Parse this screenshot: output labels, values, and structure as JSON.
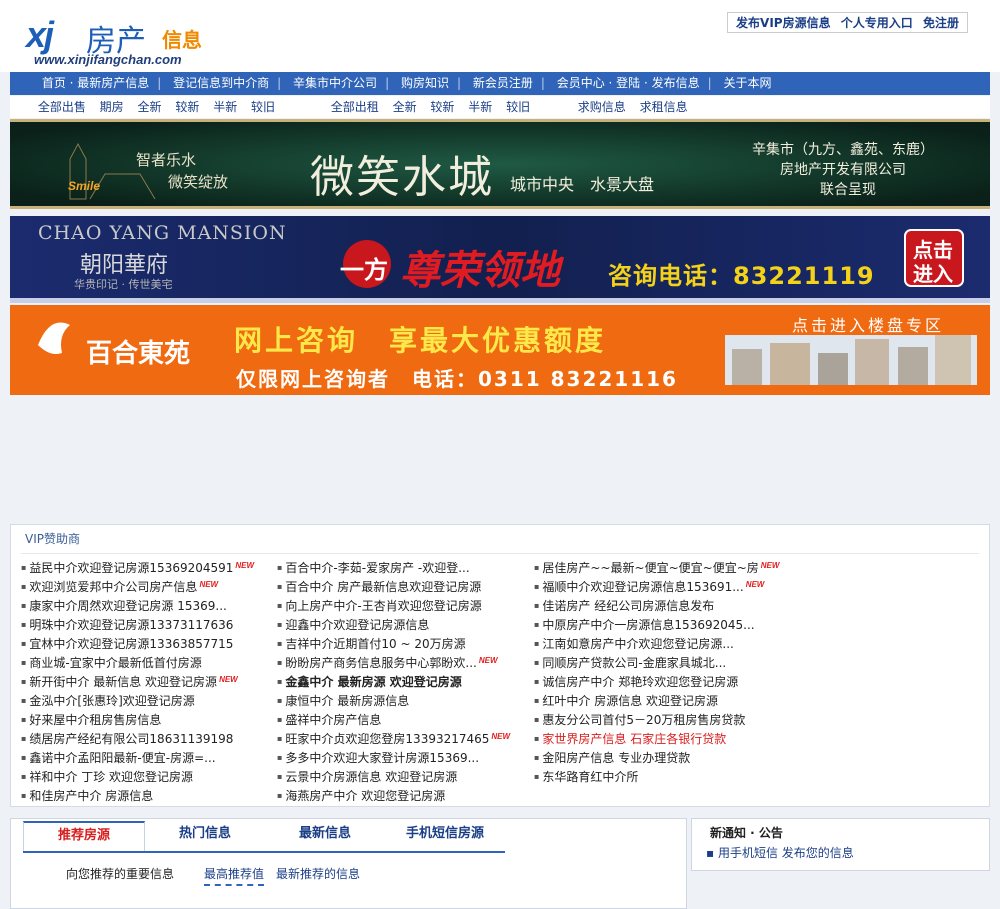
{
  "header": {
    "logo_xj": "xj",
    "logo_fc": "房产",
    "logo_xx": "信息",
    "logo_url": "www.xinjifangchan.com",
    "top_links": [
      "发布VIP房源信息",
      "个人专用入口",
      "免注册"
    ]
  },
  "nav": [
    "首页 · 最新房产信息",
    "登记信息到中介商",
    "辛集市中介公司",
    "购房知识",
    "新会员注册",
    "会员中心 · 登陆 · 发布信息",
    "关于本网"
  ],
  "subnav": {
    "sale": [
      "全部出售",
      "期房",
      "全新",
      "较新",
      "半新",
      "较旧"
    ],
    "rent": [
      "全部出租",
      "全新",
      "较新",
      "半新",
      "较旧"
    ],
    "other": [
      "求购信息",
      "求租信息"
    ]
  },
  "banners": {
    "b1": {
      "slogan1": "智者乐水",
      "slogan2": "微笑绽放",
      "brand": "Smile",
      "title": "微笑水城",
      "sub": "城市中央　水景大盘",
      "company1": "辛集市（九方、鑫苑、东鹿）",
      "company2": "房地产开发有限公司",
      "company3": "联合呈现"
    },
    "b2": {
      "en": "CHAO YANG MANSION",
      "cn": "朝阳華府",
      "slogan": "华贵印记 · 传世美宅",
      "one": "一方",
      "lead": "尊荣领地",
      "phone": "咨询电话：83221119",
      "btn1": "点击",
      "btn2": "进入"
    },
    "b3": {
      "name": "百合東苑",
      "line1": "网上咨询　享最大优惠额度",
      "line2": "仅限网上咨询者　电话：0311 83221116",
      "enter": "点击进入楼盘专区"
    }
  },
  "vip": {
    "title": "VIP赞助商",
    "col1": [
      {
        "t": "益民中介欢迎登记房源15369204591",
        "new": true
      },
      {
        "t": "欢迎浏览爱邦中介公司房产信息",
        "new": true
      },
      {
        "t": "康家中介周然欢迎登记房源 15369..."
      },
      {
        "t": "明珠中介欢迎登记房源13373117636"
      },
      {
        "t": "宜林中介欢迎登记房源13363857715"
      },
      {
        "t": "商业城-宜家中介最新低首付房源"
      },
      {
        "t": "新开街中介 最新信息 欢迎登记房源",
        "new": true
      },
      {
        "t": "金泓中介[张惠玲]欢迎登记房源"
      },
      {
        "t": "好来屋中介租房售房信息"
      },
      {
        "t": "绩居房产经纪有限公司18631139198"
      },
      {
        "t": "鑫诺中介孟阳阳最新-便宜-房源=..."
      },
      {
        "t": "祥和中介 丁珍 欢迎您登记房源"
      },
      {
        "t": "和佳房产中介 房源信息"
      }
    ],
    "col2": [
      {
        "t": "百合中介-李茹-爱家房产 -欢迎登..."
      },
      {
        "t": "百合中介 房产最新信息欢迎登记房源"
      },
      {
        "t": "向上房产中介-王杏肖欢迎您登记房源"
      },
      {
        "t": "迎鑫中介欢迎登记房源信息"
      },
      {
        "t": "吉祥中介近期首付10 ~ 20万房源"
      },
      {
        "t": "盼盼房产商务信息服务中心郭盼欢...",
        "new": true
      },
      {
        "t": "金鑫中介 最新房源 欢迎登记房源",
        "bold": true
      },
      {
        "t": "康恒中介 最新房源信息"
      },
      {
        "t": "盛祥中介房产信息"
      },
      {
        "t": "旺家中介贞欢迎您登房13393217465",
        "new": true
      },
      {
        "t": "多多中介欢迎大家登计房源15369..."
      },
      {
        "t": "云景中介房源信息 欢迎登记房源"
      },
      {
        "t": "海燕房产中介 欢迎您登记房源"
      }
    ],
    "col3": [
      {
        "t": "居佳房产~~最新~便宜~便宜~便宜~房",
        "new": true
      },
      {
        "t": "福顺中介欢迎登记房源信息153691...",
        "new": true
      },
      {
        "t": "佳诺房产 经纪公司房源信息发布"
      },
      {
        "t": "中原房产中介一房源信息153692045..."
      },
      {
        "t": "江南如意房产中介欢迎您登记房源..."
      },
      {
        "t": "同顺房产贷款公司-金鹿家具城北..."
      },
      {
        "t": "诚信房产中介 郑艳玲欢迎您登记房源"
      },
      {
        "t": "红叶中介 房源信息 欢迎登记房源"
      },
      {
        "t": "惠友分公司首付5－20万租房售房贷款"
      },
      {
        "t": "家世界房产信息 石家庄各银行贷款",
        "red": true
      },
      {
        "t": "金阳房产信息 专业办理贷款"
      },
      {
        "t": "东华路育红中介所"
      }
    ]
  },
  "new_label": "NEW",
  "tabs": [
    "推荐房源",
    "热门信息",
    "最新信息",
    "手机短信房源"
  ],
  "recommend": {
    "intro": "向您推荐的重要信息",
    "link1": "最高推荐值",
    "link2": "最新推荐的信息"
  },
  "notice": {
    "title": "新通知 · 公告",
    "item": "用手机短信 发布您的信息"
  }
}
